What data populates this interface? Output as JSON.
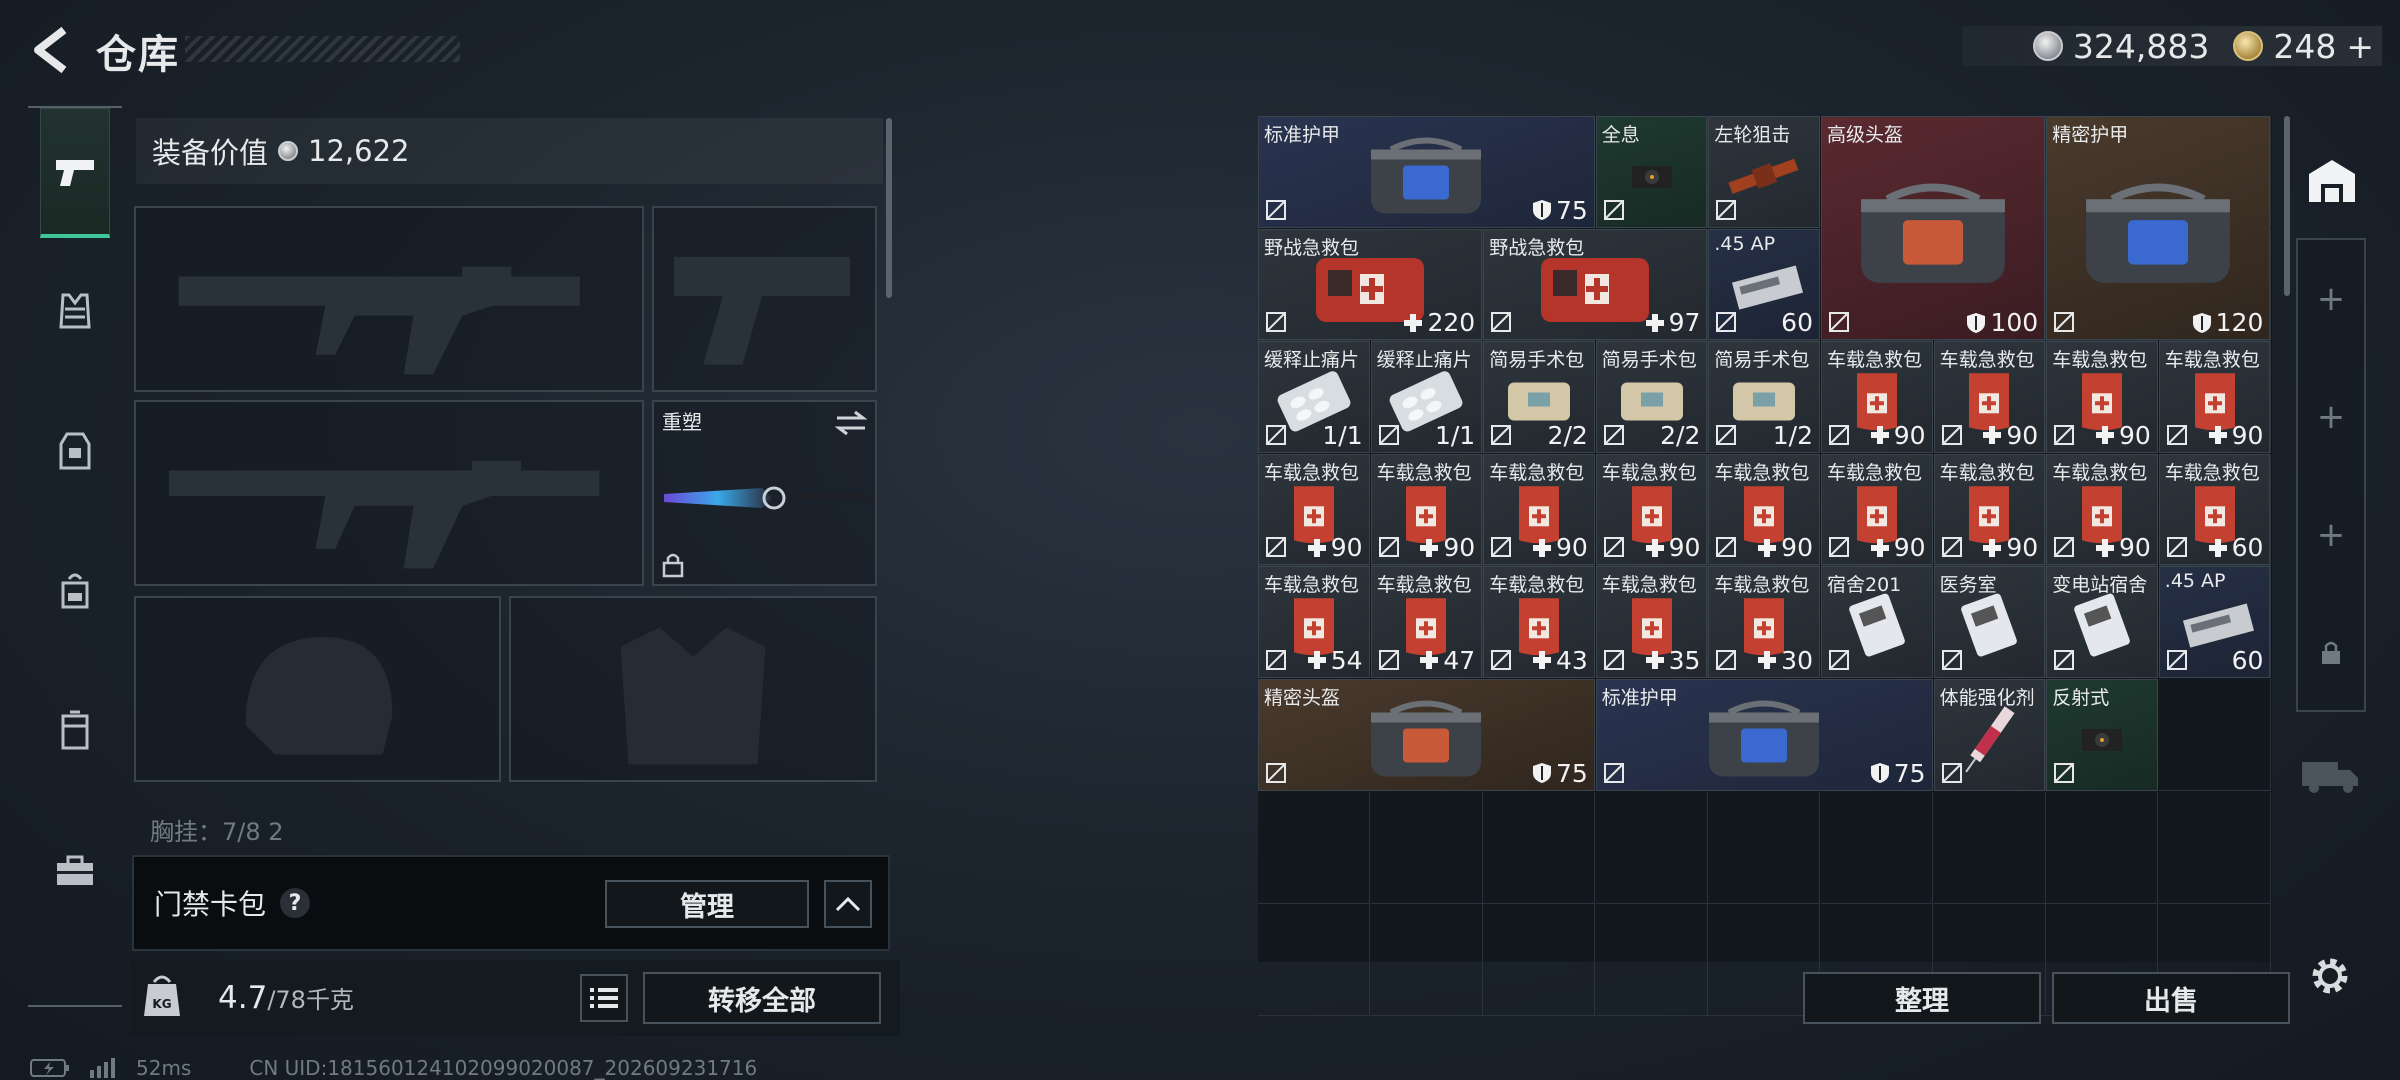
{
  "header": {
    "title": "仓库",
    "currency_silver": "324,883",
    "currency_gold": "248",
    "gold_plus": "+"
  },
  "loadout": {
    "equip_value_label": "装备价值",
    "equip_value": "12,622",
    "melee_label": "重塑",
    "chest_label": "胸挂：7/8 2",
    "keycard_label": "门禁卡包",
    "keycard_help": "?",
    "manage_label": "管理",
    "weight_current": "4.7",
    "weight_total": "/78千克",
    "transfer_label": "转移全部"
  },
  "warehouse": {
    "sort_label": "整理",
    "sell_label": "出售"
  },
  "status": {
    "ping": "52ms",
    "uid": "CN UID:18156012410209902008​7_202609231716"
  },
  "items": [
    {
      "name": "标准护甲",
      "value": "75",
      "icon": "shield",
      "bg": "blue"
    },
    {
      "name": "全息",
      "value": "",
      "icon": "",
      "bg": "green"
    },
    {
      "name": "左轮狙击",
      "value": "",
      "icon": "",
      "bg": "gray"
    },
    {
      "name": "高级头盔",
      "value": "100",
      "icon": "shield",
      "bg": "red"
    },
    {
      "name": "精密护甲",
      "value": "120",
      "icon": "shield",
      "bg": "brown"
    },
    {
      "name": "野战急救包",
      "value": "220",
      "icon": "plus",
      "bg": "gray"
    },
    {
      "name": "野战急救包",
      "value": "97",
      "icon": "plus",
      "bg": "gray"
    },
    {
      "name": ".45 AP",
      "value": "60",
      "icon": "",
      "bg": "navy"
    },
    {
      "name": "缓释止痛片",
      "value": "1/1",
      "icon": "",
      "bg": "gray"
    },
    {
      "name": "缓释止痛片",
      "value": "1/1",
      "icon": "",
      "bg": "gray"
    },
    {
      "name": "简易手术包",
      "value": "2/2",
      "icon": "",
      "bg": "gray"
    },
    {
      "name": "简易手术包",
      "value": "2/2",
      "icon": "",
      "bg": "gray"
    },
    {
      "name": "简易手术包",
      "value": "1/2",
      "icon": "",
      "bg": "gray"
    },
    {
      "name": "车载急救包",
      "value": "90",
      "icon": "plus",
      "bg": "gray"
    },
    {
      "name": "车载急救包",
      "value": "90",
      "icon": "plus",
      "bg": "gray"
    },
    {
      "name": "车载急救包",
      "value": "90",
      "icon": "plus",
      "bg": "gray"
    },
    {
      "name": "车载急救包",
      "value": "90",
      "icon": "plus",
      "bg": "gray"
    },
    {
      "name": "车载急救包",
      "value": "90",
      "icon": "plus",
      "bg": "gray"
    },
    {
      "name": "车载急救包",
      "value": "90",
      "icon": "plus",
      "bg": "gray"
    },
    {
      "name": "车载急救包",
      "value": "90",
      "icon": "plus",
      "bg": "gray"
    },
    {
      "name": "车载急救包",
      "value": "90",
      "icon": "plus",
      "bg": "gray"
    },
    {
      "name": "车载急救包",
      "value": "90",
      "icon": "plus",
      "bg": "gray"
    },
    {
      "name": "车载急救包",
      "value": "90",
      "icon": "plus",
      "bg": "gray"
    },
    {
      "name": "车载急救包",
      "value": "90",
      "icon": "plus",
      "bg": "gray"
    },
    {
      "name": "车载急救包",
      "value": "90",
      "icon": "plus",
      "bg": "gray"
    },
    {
      "name": "车载急救包",
      "value": "60",
      "icon": "plus",
      "bg": "gray"
    },
    {
      "name": "车载急救包",
      "value": "54",
      "icon": "plus",
      "bg": "gray"
    },
    {
      "name": "车载急救包",
      "value": "47",
      "icon": "plus",
      "bg": "gray"
    },
    {
      "name": "车载急救包",
      "value": "43",
      "icon": "plus",
      "bg": "gray"
    },
    {
      "name": "车载急救包",
      "value": "35",
      "icon": "plus",
      "bg": "gray"
    },
    {
      "name": "车载急救包",
      "value": "30",
      "icon": "plus",
      "bg": "gray"
    },
    {
      "name": "宿舍201",
      "value": "",
      "icon": "",
      "bg": "gray"
    },
    {
      "name": "医务室",
      "value": "",
      "icon": "",
      "bg": "gray"
    },
    {
      "name": "变电站宿舍",
      "value": "",
      "icon": "",
      "bg": "gray"
    },
    {
      "name": ".45 AP",
      "value": "60",
      "icon": "",
      "bg": "navy"
    },
    {
      "name": "精密头盔",
      "value": "75",
      "icon": "shield",
      "bg": "brown"
    },
    {
      "name": "标准护甲",
      "value": "75",
      "icon": "shield",
      "bg": "blue"
    },
    {
      "name": "体能强化剂",
      "value": "",
      "icon": "",
      "bg": "gray"
    },
    {
      "name": "反射式",
      "value": "",
      "icon": "",
      "bg": "green"
    }
  ]
}
